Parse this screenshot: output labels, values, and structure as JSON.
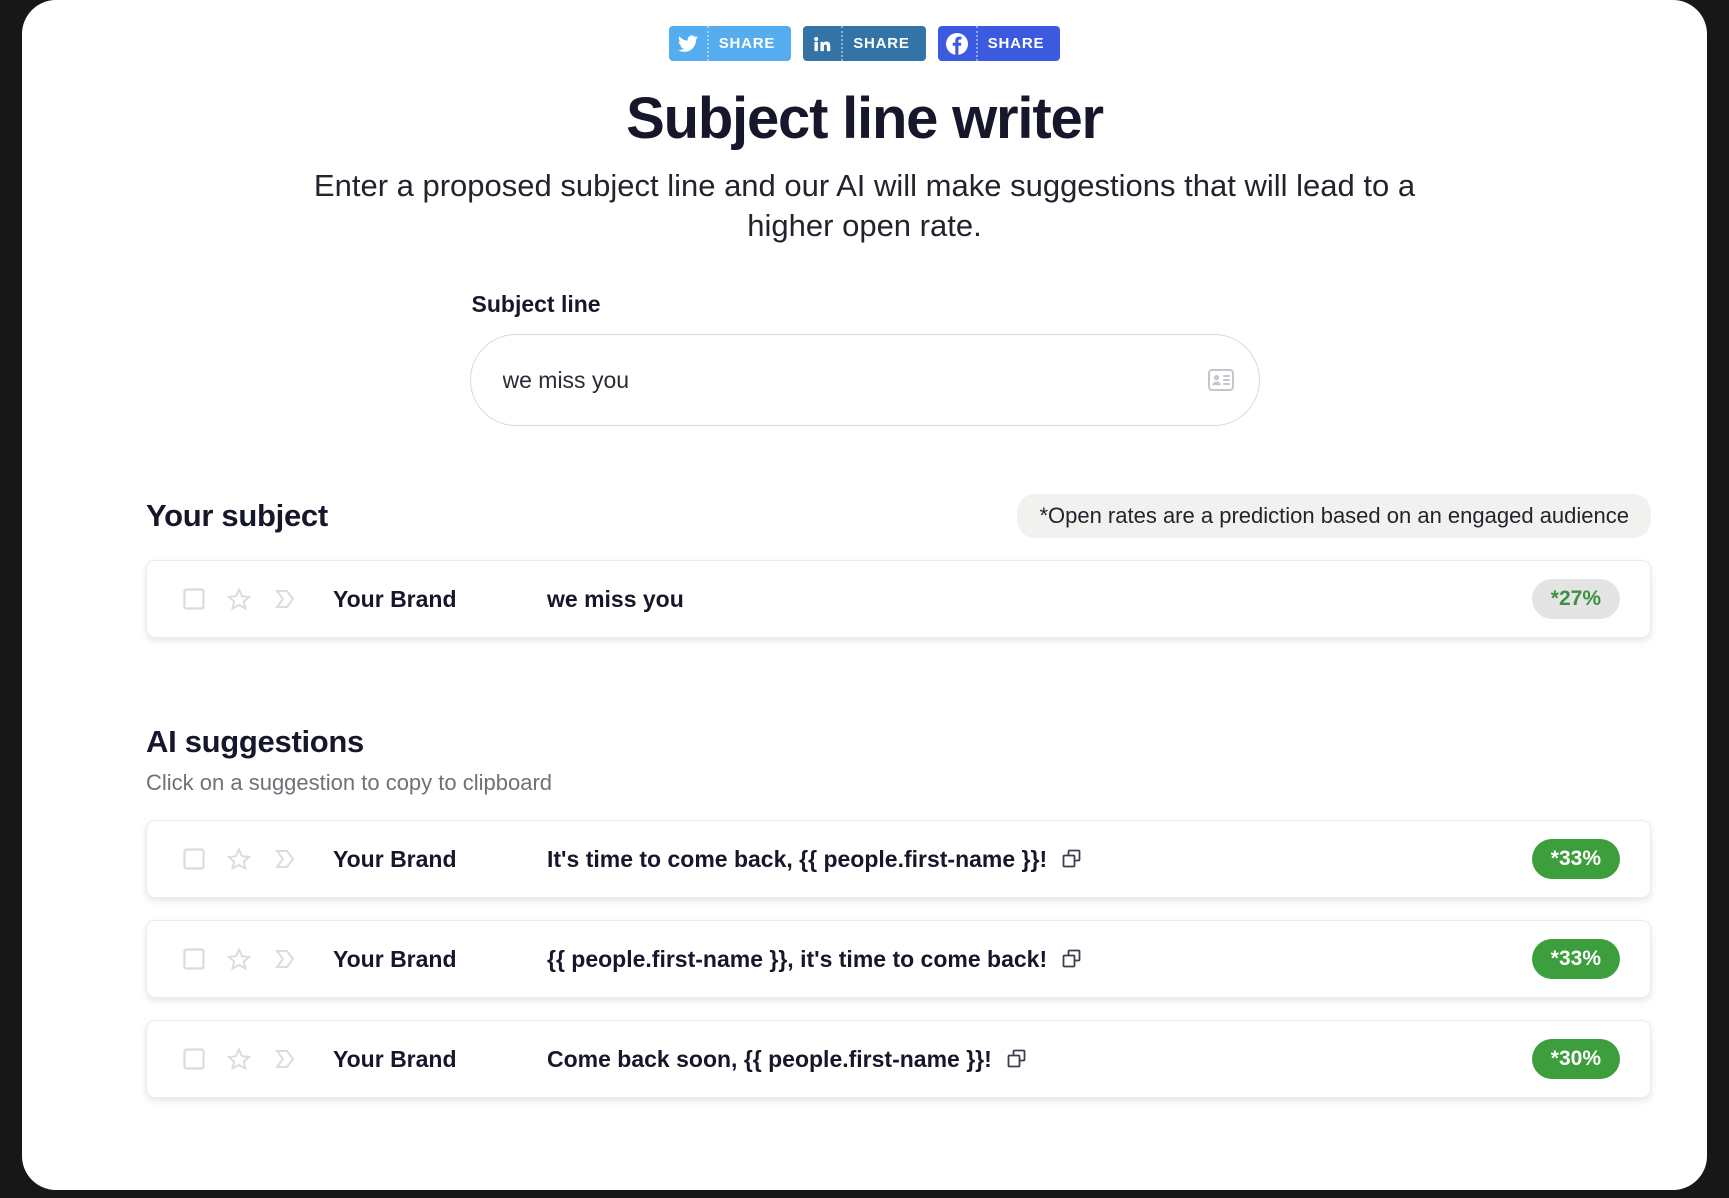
{
  "share": {
    "buttons": [
      {
        "network": "twitter",
        "icon": "twitter-icon",
        "label": "SHARE",
        "color": "#55acee"
      },
      {
        "network": "linkedin",
        "icon": "linkedin-icon",
        "label": "SHARE",
        "color": "#3473a5"
      },
      {
        "network": "facebook",
        "icon": "facebook-icon",
        "label": "SHARE",
        "color": "#3b5ae0"
      }
    ]
  },
  "header": {
    "title": "Subject line writer",
    "subtitle": "Enter a proposed subject line and our AI will make suggestions that will lead to a higher open rate."
  },
  "form": {
    "label": "Subject line",
    "value": "we miss you",
    "placeholder": "we miss you",
    "icon": "contact-card-icon"
  },
  "your_subject": {
    "title": "Your subject",
    "disclaimer": "*Open rates are a prediction based on an engaged audience",
    "rows": [
      {
        "brand": "Your Brand",
        "subject": "we miss you",
        "rate": "*27%",
        "badge_style": "grey",
        "has_copy": false
      }
    ]
  },
  "ai_suggestions": {
    "title": "AI suggestions",
    "subtitle": "Click on a suggestion to copy to clipboard",
    "rows": [
      {
        "brand": "Your Brand",
        "subject": "It's time to come back, {{ people.first-name }}!",
        "rate": "*33%",
        "badge_style": "green",
        "has_copy": true
      },
      {
        "brand": "Your Brand",
        "subject": "{{ people.first-name }}, it's time to come back!",
        "rate": "*33%",
        "badge_style": "green",
        "has_copy": true
      },
      {
        "brand": "Your Brand",
        "subject": "Come back soon, {{ people.first-name }}!",
        "rate": "*30%",
        "badge_style": "green",
        "has_copy": true
      }
    ]
  },
  "colors": {
    "page_background": "#ffffff",
    "screen_background": "#171717",
    "text_primary": "#17172b",
    "text_muted": "#6f7179",
    "badge_green": "#3c9e3c",
    "badge_grey": "#e4e4e4",
    "badge_grey_text": "#3b9141",
    "disclaimer_bg": "#f1f1ef"
  }
}
